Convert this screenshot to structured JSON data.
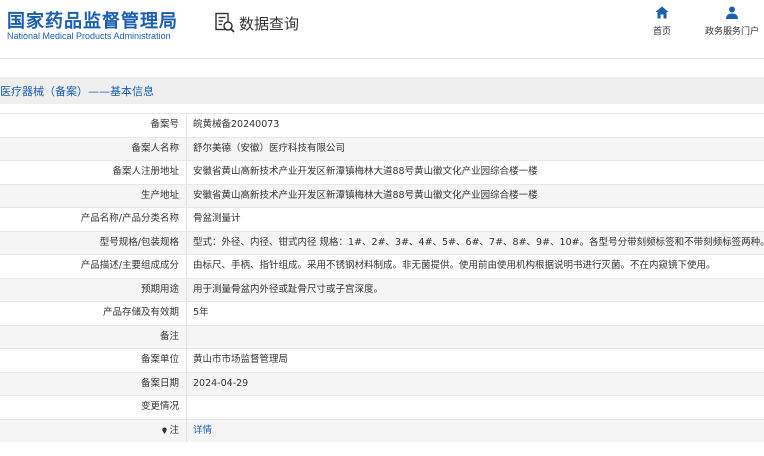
{
  "header": {
    "logo_cn": "国家药品监督管理局",
    "logo_en": "National Medical Products Administration",
    "query_label": "数据查询",
    "nav": {
      "home_label": "首页",
      "service_label": "政务服务门户"
    },
    "accent_color": "#1a5fb4"
  },
  "breadcrumb": {
    "text": "医疗器械（备案）——基本信息"
  },
  "rows": [
    {
      "label": "备案号",
      "value": "皖黄械备20240073"
    },
    {
      "label": "备案人名称",
      "value": "舒尔美德（安徽）医疗科技有限公司"
    },
    {
      "label": "备案人注册地址",
      "value": "安徽省黄山高新技术产业开发区新潭镇梅林大道88号黄山徽文化产业园综合楼一楼"
    },
    {
      "label": "生产地址",
      "value": "安徽省黄山高新技术产业开发区新潭镇梅林大道88号黄山徽文化产业园综合楼一楼"
    },
    {
      "label": "产品名称/产品分类名称",
      "value": "骨盆测量计"
    },
    {
      "label": "型号规格/包装规格",
      "value": "型式：外径、内径、钳式内径 规格：1#、2#、3#、4#、5#、6#、7#、8#、9#、10#。各型号分带刻频标签和不带刻频标签两种。"
    },
    {
      "label": "产品描述/主要组成成分",
      "value": "由标尺、手柄、指针组成。采用不锈钢材料制成。非无菌提供。使用前由使用机构根据说明书进行灭菌。不在内窥镜下使用。"
    },
    {
      "label": "预期用途",
      "value": "用于测量骨盆内外径或趾骨尺寸或子宫深度。"
    },
    {
      "label": "产品存储及有效期",
      "value": "5年"
    },
    {
      "label": "备注",
      "value": ""
    },
    {
      "label": "备案单位",
      "value": "黄山市市场监督管理局"
    },
    {
      "label": "备案日期",
      "value": "2024-04-29"
    },
    {
      "label": "变更情况",
      "value": ""
    },
    {
      "label": "注",
      "value": "详情",
      "icon": "pin-icon"
    }
  ]
}
